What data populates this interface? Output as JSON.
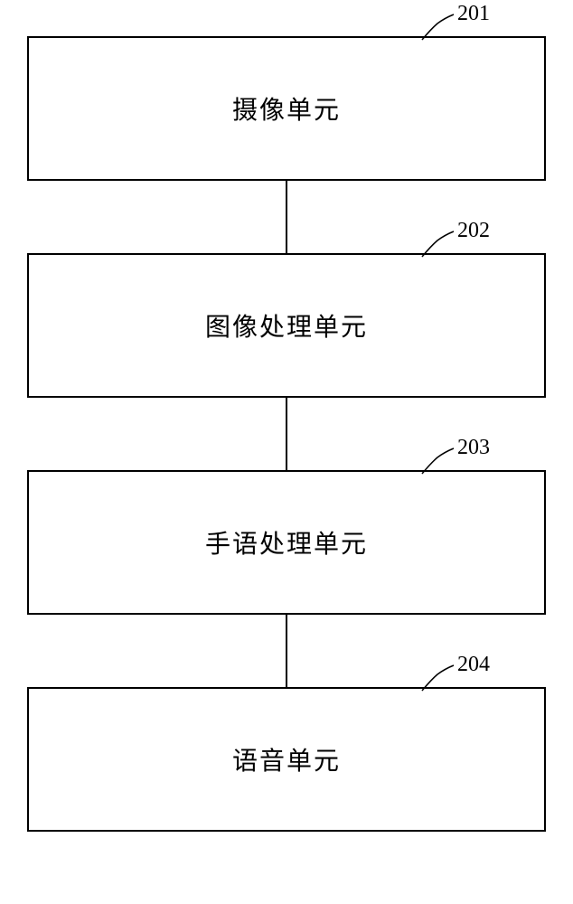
{
  "blocks": [
    {
      "label": "摄像单元",
      "ref": "201"
    },
    {
      "label": "图像处理单元",
      "ref": "202"
    },
    {
      "label": "手语处理单元",
      "ref": "203"
    },
    {
      "label": "语音单元",
      "ref": "204"
    }
  ]
}
